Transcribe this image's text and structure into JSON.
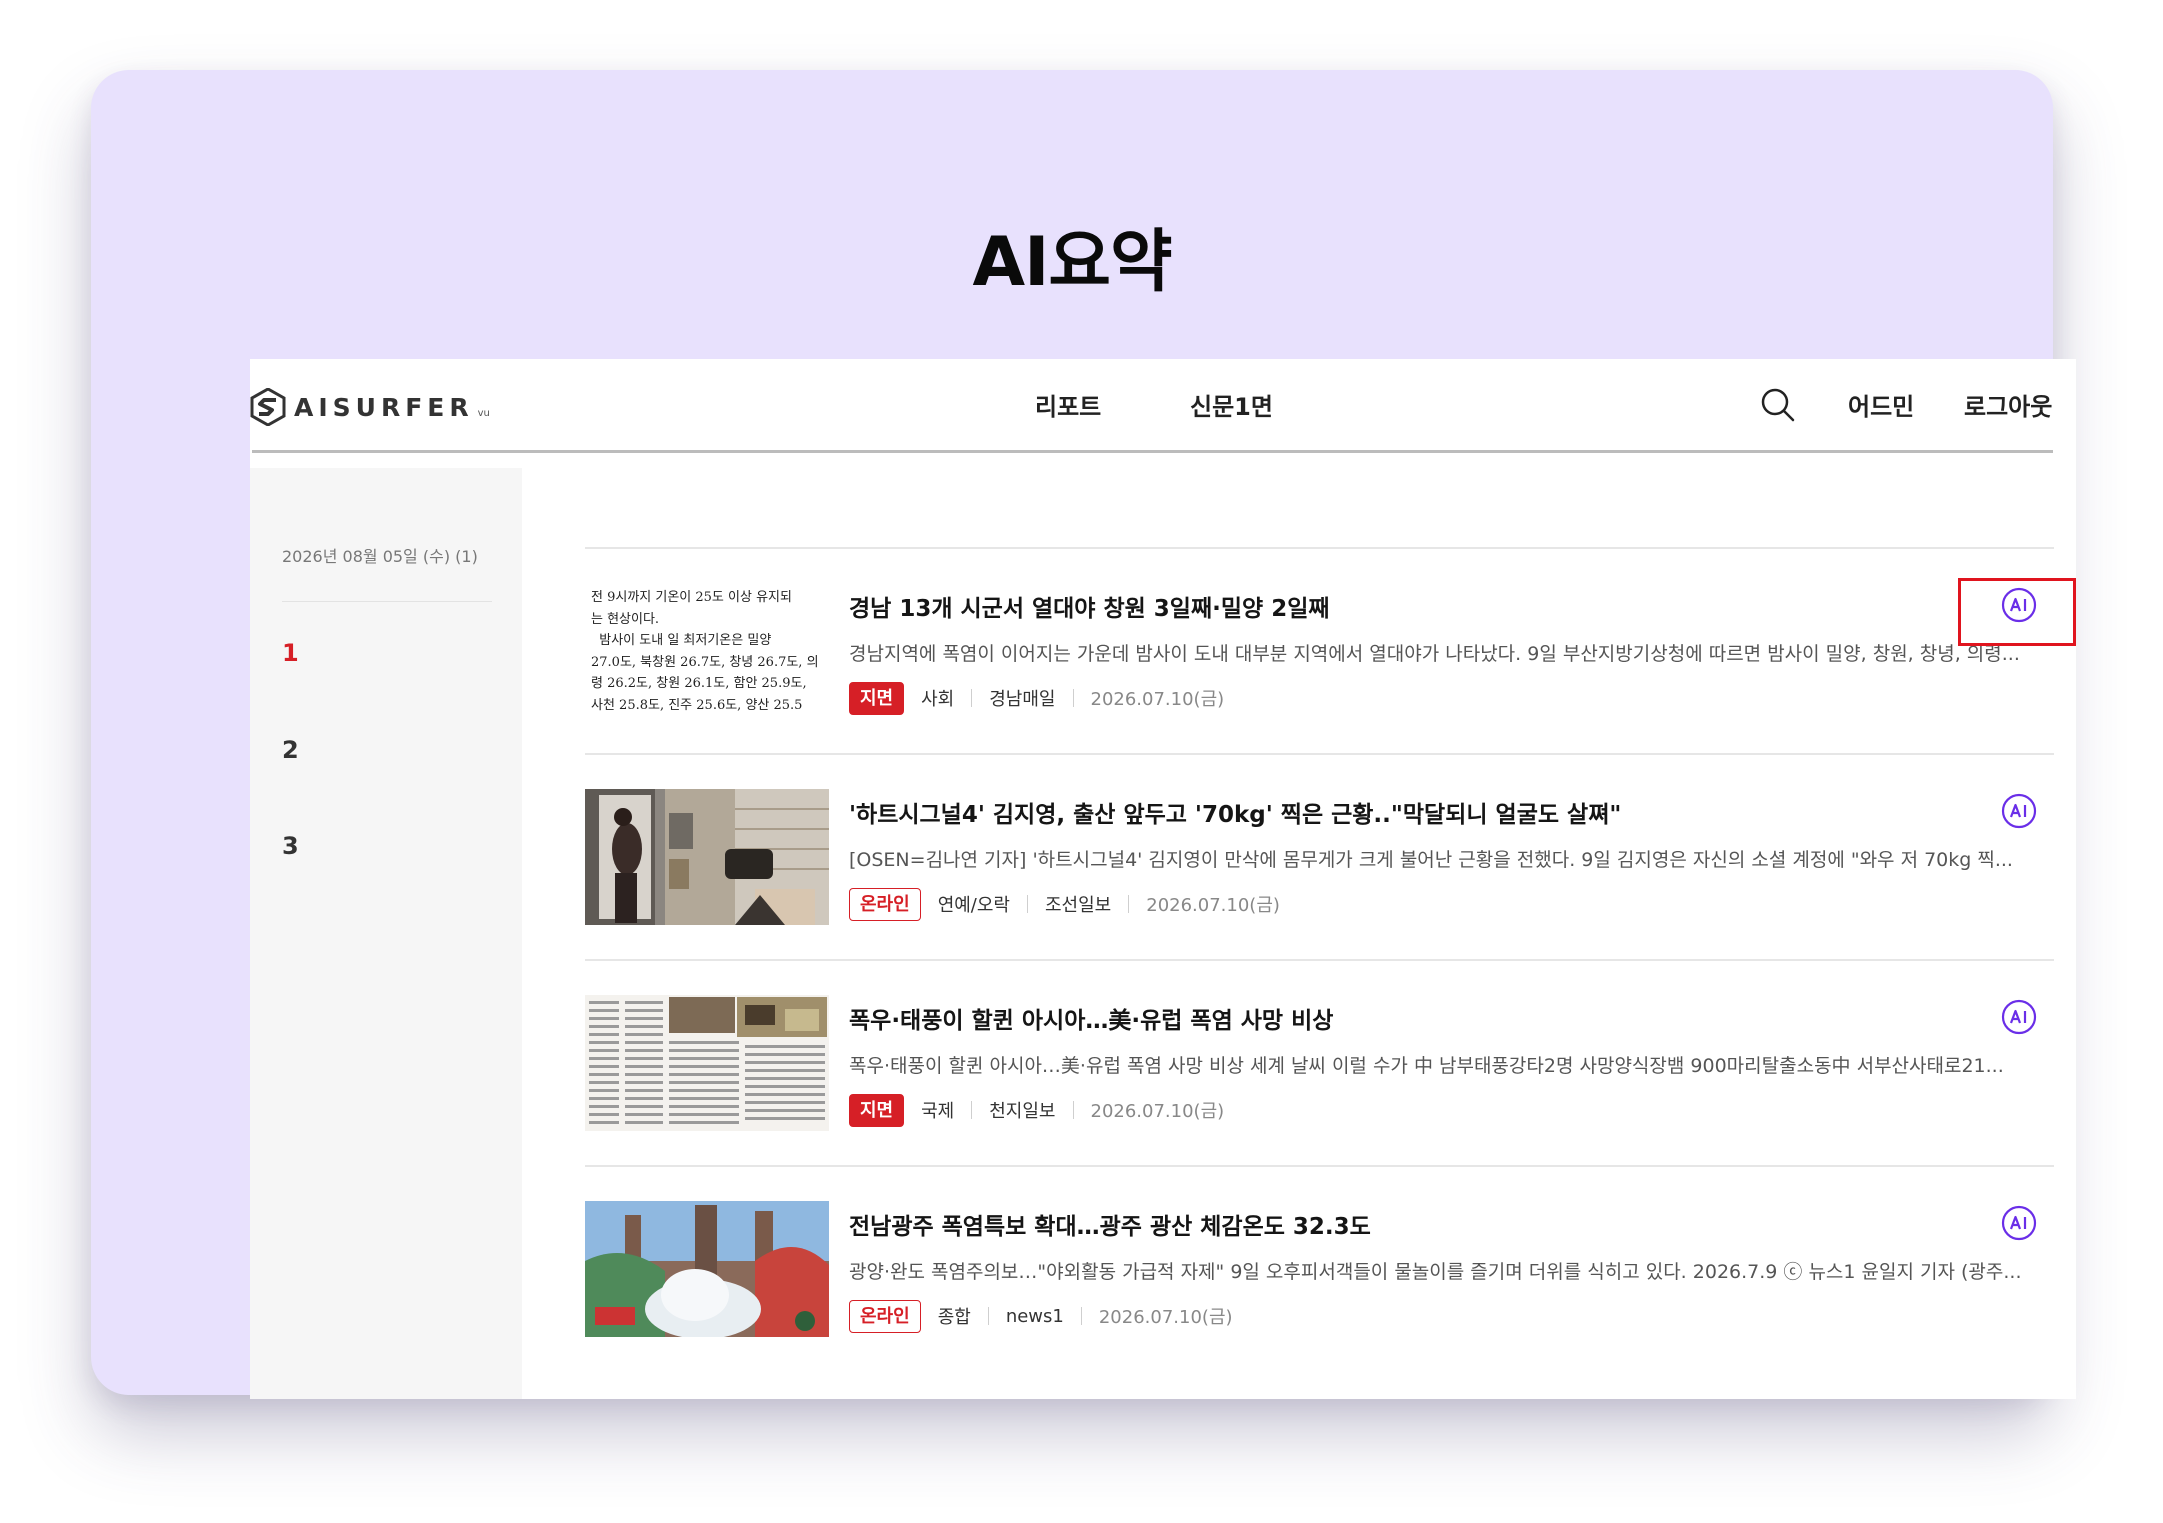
{
  "page_title": "AI요약",
  "header": {
    "logo_text": "AISURFER",
    "logo_sub": "vu",
    "nav": [
      "리포트",
      "신문1면"
    ],
    "admin_label": "어드민",
    "logout_label": "로그아웃"
  },
  "sidebar": {
    "date_label": "2026년 08월 05일 (수) (1)",
    "pages": [
      "1",
      "2",
      "3"
    ],
    "active_page": "1"
  },
  "articles": [
    {
      "thumb_text": [
        "전 9시까지 기온이 25도 이상 유지되",
        "는 현상이다.",
        "  밤사이 도내 일 최저기온은 밀양",
        "27.0도, 북창원 26.7도, 창녕 26.7도, 의",
        "령 26.2도, 창원 26.1도, 함안 25.9도,",
        "사천 25.8도, 진주 25.6도, 양산 25.5"
      ],
      "title": "경남 13개 시군서 열대야 창원 3일째·밀양 2일째",
      "summary": "경남지역에 폭염이 이어지는 가운데 밤사이 도내 대부분 지역에서 열대야가 나타났다. 9일 부산지방기상청에 따르면 밤사이 밀양, 창원, 창녕, 의령...",
      "badge": "지면",
      "badge_type": "print",
      "category": "사회",
      "source": "경남매일",
      "date": "2026.07.10(금)"
    },
    {
      "title": "'하트시그널4' 김지영, 출산 앞두고 '70kg' 찍은 근황..\"막달되니 얼굴도 살쪄\"",
      "summary": "[OSEN=김나연 기자] '하트시그널4' 김지영이 만삭에 몸무게가 크게 불어난 근황을 전했다. 9일 김지영은 자신의 소셜 계정에 \"와우 저 70kg 찍...",
      "badge": "온라인",
      "badge_type": "online",
      "category": "연예/오락",
      "source": "조선일보",
      "date": "2026.07.10(금)"
    },
    {
      "title": "폭우·태풍이 할퀸 아시아…美·유럽 폭염 사망 비상",
      "summary": "폭우·태풍이 할퀸 아시아…美·유럽 폭염 사망 비상 세계 날씨 이럴 수가 中 남부태풍강타2명 사망양식장뱀 900마리탈출소동中 서부산사태로21...",
      "badge": "지면",
      "badge_type": "print",
      "category": "국제",
      "source": "천지일보",
      "date": "2026.07.10(금)"
    },
    {
      "title": "전남광주 폭염특보 확대…광주 광산 체감온도 32.3도",
      "summary": "광양·완도 폭염주의보…\"야외활동 가급적 자제\" 9일 오후피서객들이 물놀이를 즐기며 더위를 식히고 있다. 2026.7.9 ⓒ 뉴스1 윤일지 기자 (광주...",
      "badge": "온라인",
      "badge_type": "online",
      "category": "종합",
      "source": "news1",
      "date": "2026.07.10(금)"
    }
  ],
  "ai_button_label": "AI",
  "colors": {
    "card_bg": "#e8e1fd",
    "accent_red": "#d61f26",
    "ai_purple": "#6a2ee8",
    "highlight_red": "#e0141e"
  }
}
